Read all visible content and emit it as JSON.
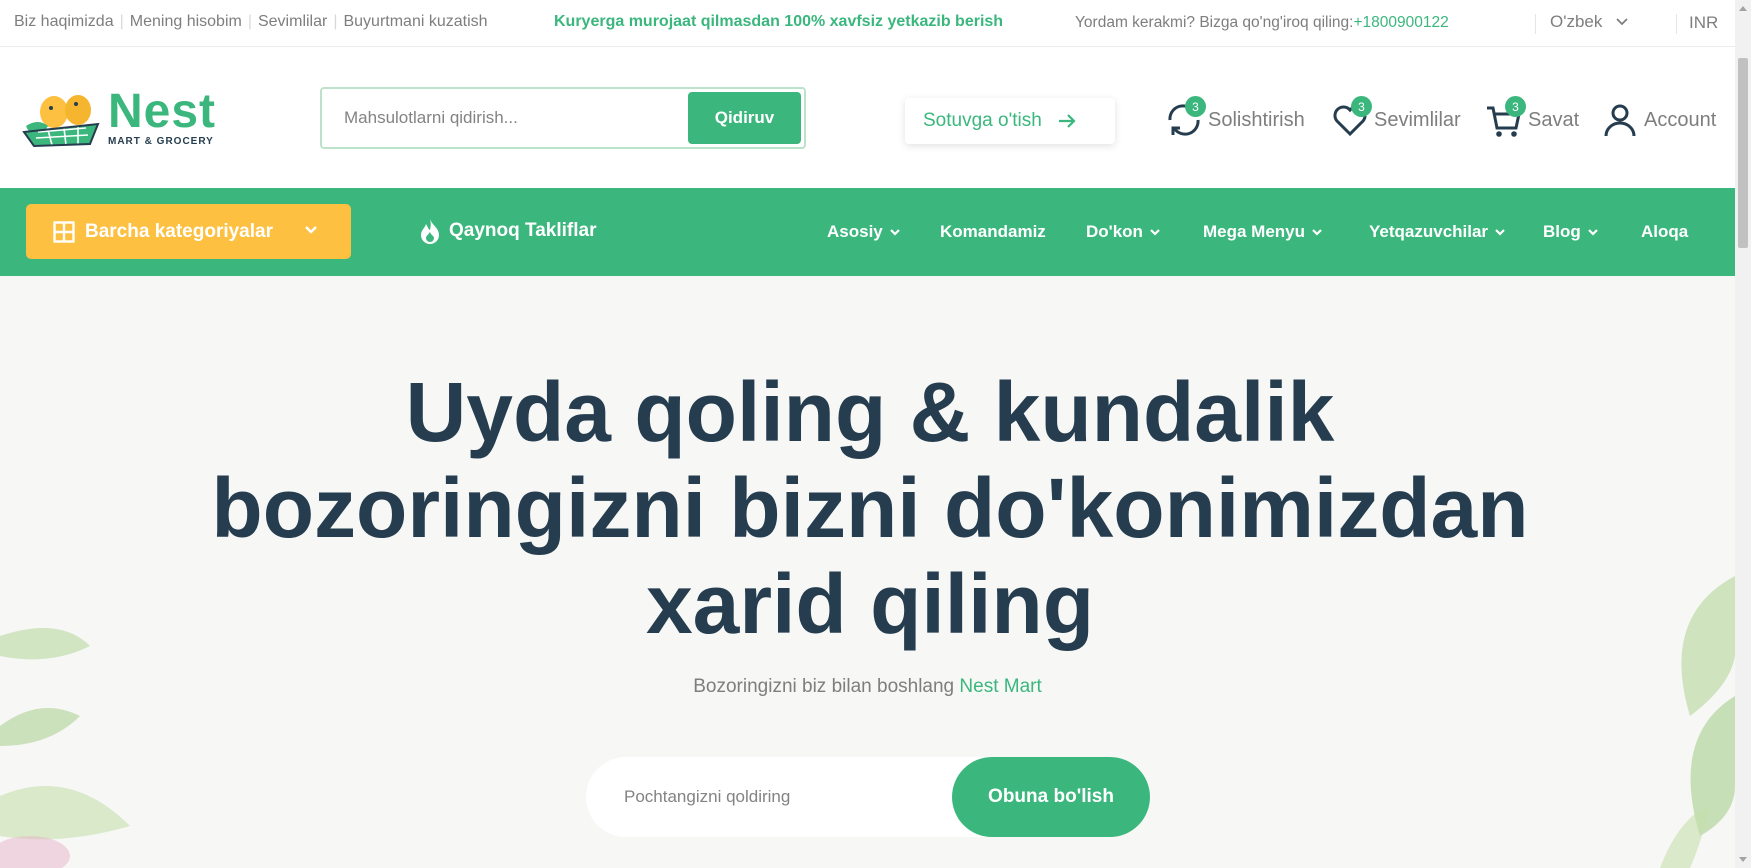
{
  "topbar": {
    "links": [
      "Biz haqimizda",
      "Mening hisobim",
      "Sevimlilar",
      "Buyurtmani kuzatish"
    ],
    "promo": "Kuryerga murojaat qilmasdan 100% xavfsiz yetkazib berish",
    "help_text": "Yordam kerakmi? Bizga qo'ng'iroq qiling:",
    "phone": "+1800900122",
    "language": "O'zbek",
    "currency": "INR"
  },
  "header": {
    "logo_name": "Nest",
    "logo_tagline": "MART & GROCERY",
    "search_placeholder": "Mahsulotlarni qidirish...",
    "search_button": "Qidiruv",
    "sell_button": "Sotuvga o'tish",
    "compare_label": "Solishtirish",
    "compare_count": "3",
    "wishlist_label": "Sevimlilar",
    "wishlist_count": "3",
    "cart_label": "Savat",
    "cart_count": "3",
    "account_label": "Account"
  },
  "nav": {
    "all_categories": "Barcha kategoriyalar",
    "hot_deals": "Qaynoq Takliflar",
    "items": [
      {
        "label": "Asosiy",
        "dropdown": true
      },
      {
        "label": "Komandamiz",
        "dropdown": false
      },
      {
        "label": "Do'kon",
        "dropdown": true
      },
      {
        "label": "Mega Menyu",
        "dropdown": true
      },
      {
        "label": "Yetqazuvchilar",
        "dropdown": true
      },
      {
        "label": "Blog",
        "dropdown": true
      },
      {
        "label": "Aloqa",
        "dropdown": false
      }
    ]
  },
  "hero": {
    "headline_line1": "Uyda qoling & kundalik",
    "headline_line2": "bozoringizni bizni do'konimizdan",
    "headline_line3": "xarid qiling",
    "subtitle": "Bozoringizni biz bilan boshlang",
    "subtitle_brand": "Nest Mart",
    "email_placeholder": "Pochtangizni qoldiring",
    "subscribe_button": "Obuna bo'lish"
  },
  "colors": {
    "brand_green": "#3bb77e",
    "category_yellow": "#fdc040",
    "heading_dark": "#253d4e",
    "muted_text": "#7e7e7e"
  }
}
